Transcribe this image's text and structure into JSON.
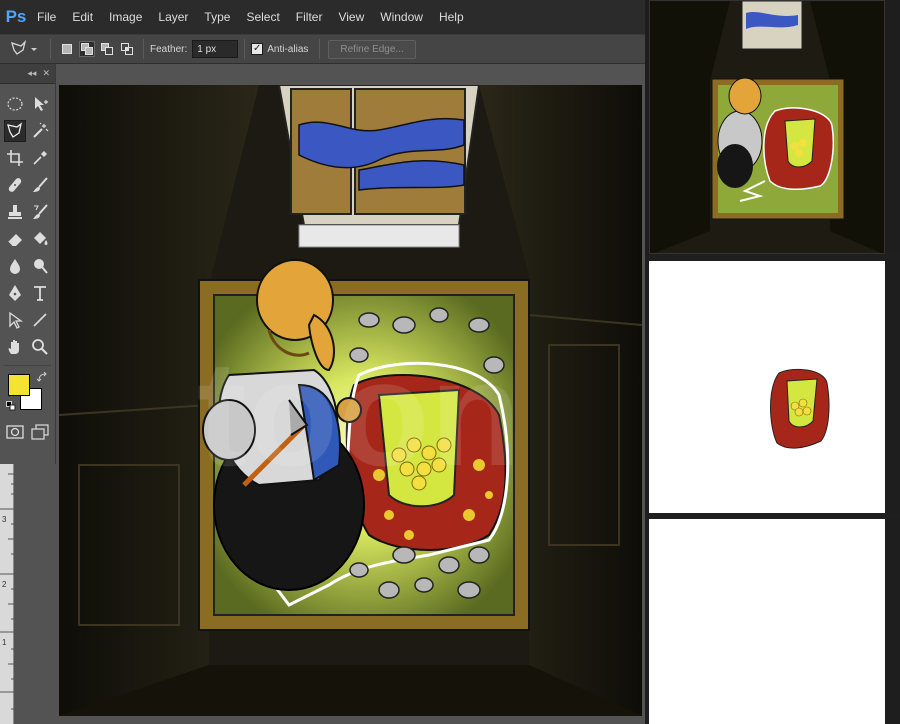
{
  "app": {
    "logo": "Ps"
  },
  "menu": [
    "File",
    "Edit",
    "Image",
    "Layer",
    "Type",
    "Select",
    "Filter",
    "View",
    "Window",
    "Help"
  ],
  "options": {
    "feather_label": "Feather:",
    "feather_value": "1 px",
    "antialias_label": "Anti-alias",
    "antialias_checked": true,
    "refine_label": "Refine Edge..."
  },
  "toolbox": {
    "collapse": "◂◂",
    "close": "✕",
    "tools": [
      [
        "marquee-icon",
        "move-icon"
      ],
      [
        "polygonal-lasso-icon",
        "magic-wand-icon"
      ],
      [
        "crop-icon",
        "eyedropper-icon"
      ],
      [
        "healing-brush-icon",
        "brush-icon"
      ],
      [
        "clone-stamp-icon",
        "history-brush-icon"
      ],
      [
        "eraser-icon",
        "paint-bucket-icon"
      ],
      [
        "blur-icon",
        "dodge-icon"
      ],
      [
        "pen-icon",
        "type-icon"
      ],
      [
        "path-selection-icon",
        "line-icon"
      ],
      [
        "hand-icon",
        "zoom-icon"
      ]
    ],
    "active_tool": "polygonal-lasso-icon",
    "foreground_color": "#f5e332",
    "background_color": "#ffffff"
  },
  "ruler": {
    "labels": [
      "3",
      "2",
      "1"
    ]
  },
  "canvas": {
    "watermark_text": "toon"
  }
}
